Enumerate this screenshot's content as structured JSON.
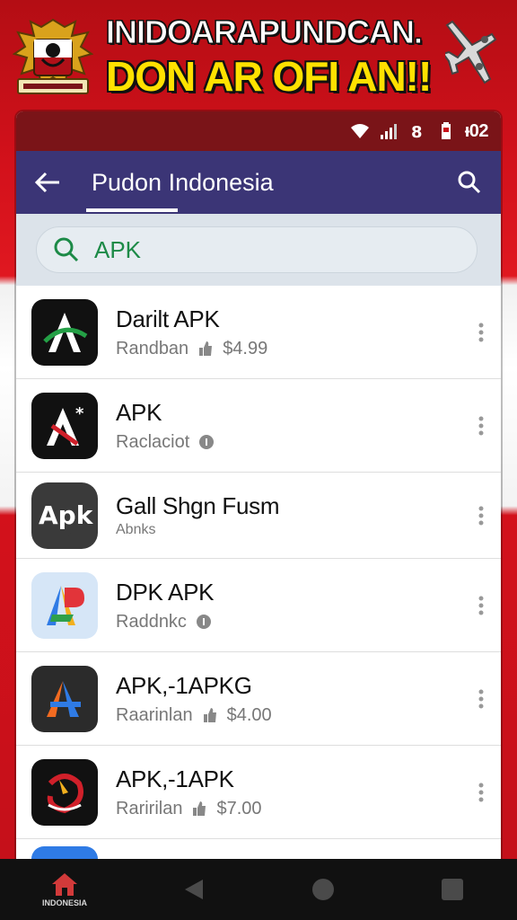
{
  "banner": {
    "line1": "INIDOARAPUNDCAN.",
    "line2": "DON AR OFI AN!!"
  },
  "status_bar": {
    "time": "ᵻ02"
  },
  "app_bar": {
    "title": "Pudon Indonesia"
  },
  "search": {
    "value": "APK"
  },
  "items": [
    {
      "title": "Darilt APK",
      "sub": "Randban",
      "price": "$4.99",
      "icon": "a-logo-black"
    },
    {
      "title": "APK",
      "sub": "Raclaciot",
      "price": "",
      "icon": "a-star-logo"
    },
    {
      "title": "Gall Shgn Fusm",
      "sub": "Abnks",
      "price": "",
      "icon": "apk-text-logo"
    },
    {
      "title": "DPK APK",
      "sub": "Raddnkc",
      "price": "",
      "icon": "colorful-a-logo"
    },
    {
      "title": "APK,-1APKG",
      "sub": "Raarinlan",
      "price": "$4.00",
      "icon": "blue-orange-a-logo"
    },
    {
      "title": "APK,-1APK",
      "sub": "Raririlan",
      "price": "$7.00",
      "icon": "red-swirl-logo"
    }
  ],
  "nav": {
    "home_label": "INDONESIA"
  },
  "colors": {
    "app_bar": "#3b3576",
    "status_bar": "#7a1418",
    "search_text": "#1c8a47",
    "banner_yellow": "#ffe100"
  }
}
